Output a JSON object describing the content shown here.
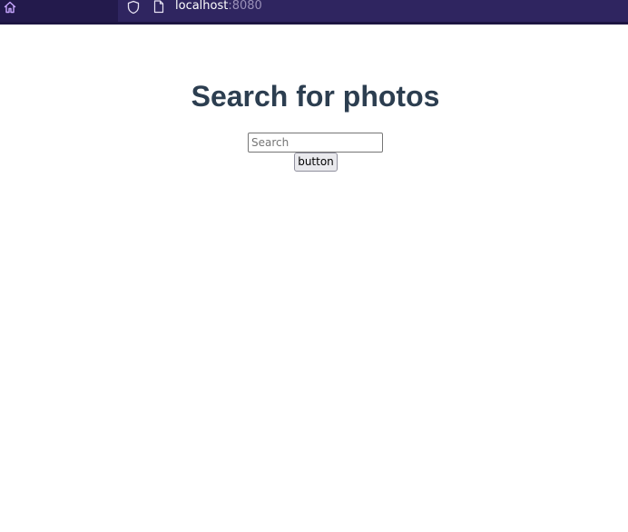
{
  "browser": {
    "url_host": "localhost",
    "url_port": ":8080",
    "colors": {
      "toolbar_bg": "#2b2158",
      "home_zone_bg": "#231a4c",
      "url_bar_bg": "#2f2560",
      "home_icon": "#c7a6ff",
      "url_host": "#ffffff",
      "url_port": "#9a90b8"
    },
    "icons": {
      "home": "home-icon",
      "shield": "shield-icon",
      "page": "page-icon"
    }
  },
  "page": {
    "title": "Search for photos",
    "title_color": "#2c3e50",
    "search": {
      "value": "",
      "placeholder": "Search"
    },
    "button_label": "button"
  }
}
